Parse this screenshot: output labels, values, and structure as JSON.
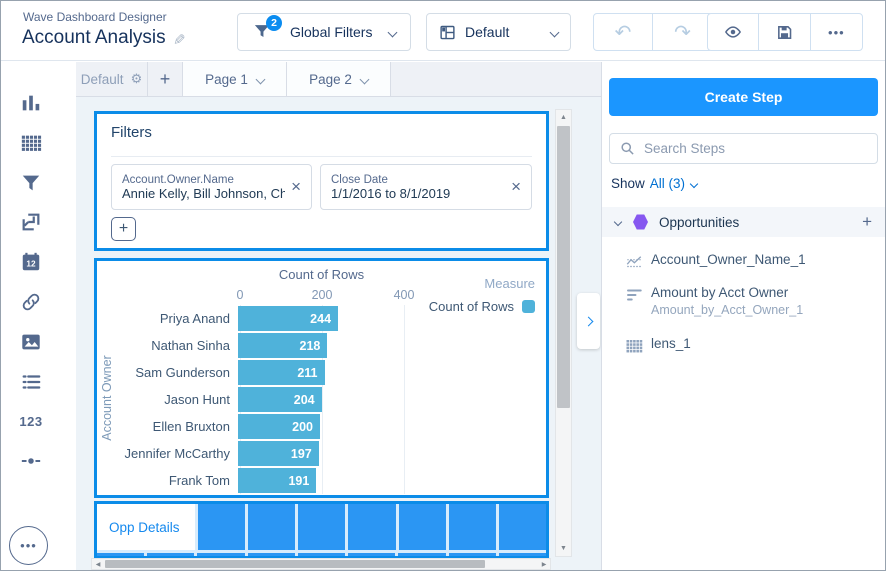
{
  "icons_glyphs": {
    "gear": "⚙",
    "pencil": "✎",
    "close": "×",
    "add": "+",
    "undo": "↶",
    "redo": "↷",
    "ellipsis": "•••",
    "arrow_up": "▲",
    "arrow_down": "▼",
    "arrow_left": "◀",
    "arrow_right": "▶",
    "numbers": "123"
  },
  "header": {
    "app_label": "Wave Dashboard Designer",
    "title": "Account Analysis",
    "global_filters": {
      "label": "Global Filters",
      "badge": "2"
    },
    "layout_select": {
      "value": "Default"
    }
  },
  "tabs": {
    "layout_tab": "Default",
    "pages": [
      "Page 1",
      "Page 2"
    ]
  },
  "sidebar": {
    "icons": [
      "bar-chart-widget-icon",
      "table-widget-icon",
      "filter-widget-icon",
      "container-widget-icon",
      "date-widget-icon",
      "link-widget-icon",
      "image-widget-icon",
      "list-widget-icon",
      "number-widget-icon",
      "toggle-widget-icon"
    ]
  },
  "canvas": {
    "filters_widget": {
      "title": "Filters",
      "chips": [
        {
          "field": "Account.Owner.Name",
          "value": "Annie Kelly, Bill Johnson, Ch..."
        },
        {
          "field": "Close Date",
          "value": "1/1/2016 to 8/1/2019"
        }
      ]
    },
    "table_widget": {
      "header_cell": "Opp Details",
      "row1_cells": 7,
      "row2_cells": 9
    }
  },
  "chart_data": {
    "type": "bar",
    "orientation": "horizontal",
    "title": "Count of Rows",
    "categories": [
      "Priya Anand",
      "Nathan Sinha",
      "Sam Gunderson",
      "Jason Hunt",
      "Ellen Bruxton",
      "Jennifer McCarthy",
      "Frank Tom"
    ],
    "values": [
      244,
      218,
      211,
      204,
      200,
      197,
      191
    ],
    "xlim": [
      0,
      400
    ],
    "xticks": [
      0,
      200,
      400
    ],
    "ylabel": "Account Owner",
    "legend": {
      "title": "Measure",
      "items": [
        "Count of Rows"
      ],
      "position": "right"
    },
    "bar_color": "#4fb2da",
    "grid": true
  },
  "right_panel": {
    "create_step_label": "Create Step",
    "search_placeholder": "Search Steps",
    "show_label": "Show",
    "show_filter": "All (3)",
    "dataset": {
      "name": "Opportunities"
    },
    "steps": [
      {
        "title": "Account_Owner_Name_1",
        "subtitle": "",
        "icon": "timeline-chart-icon"
      },
      {
        "title": "Amount by Acct Owner",
        "subtitle": "Amount_by_Acct_Owner_1",
        "icon": "hbar-chart-icon"
      },
      {
        "title": "lens_1",
        "subtitle": "",
        "icon": "table-icon"
      }
    ]
  },
  "colors": {
    "accent_blue": "#1b96ff",
    "selection_border": "#0b8ce8",
    "bar_fill": "#4fb2da",
    "table_cell": "#2b96f3",
    "badge": "#0b8cf0",
    "dataset_hexagon": "#8657f0",
    "link_blue": "#0070d2"
  }
}
